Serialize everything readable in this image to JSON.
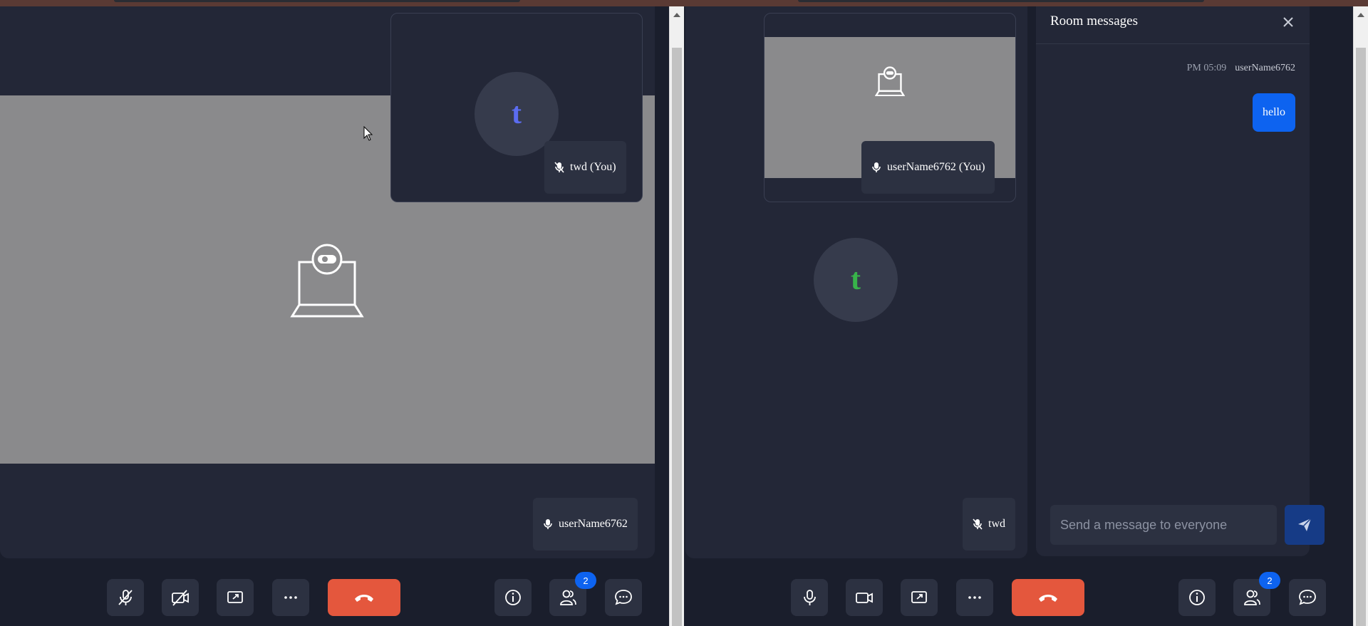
{
  "left_window": {
    "self_tile": {
      "avatar_letter": "t",
      "name": "twd (You)",
      "avatar_color": "#5b6cf0"
    },
    "main_participant": {
      "name": "userName6762"
    },
    "controls": {
      "participants_count": "2"
    }
  },
  "right_window": {
    "self_tile": {
      "name": "userName6762 (You)"
    },
    "remote_participant": {
      "avatar_letter": "t",
      "name": "twd",
      "avatar_color": "#38b34a"
    },
    "chat": {
      "title": "Room messages",
      "message": {
        "time": "PM 05:09",
        "sender": "userName6762",
        "text": "hello"
      },
      "input_placeholder": "Send a message to everyone"
    },
    "controls": {
      "participants_count": "2"
    }
  },
  "colors": {
    "background": "#1a1e2c",
    "stage": "#232737",
    "button": "#2c3141",
    "hangup": "#e4573d",
    "accent": "#0d63f0",
    "video_placeholder": "#8a8a8c"
  },
  "icons": [
    "mic-off-icon",
    "camera-off-icon",
    "share-screen-icon",
    "more-icon",
    "hangup-icon",
    "info-icon",
    "participants-icon",
    "chat-icon",
    "mic-icon",
    "camera-icon",
    "send-icon",
    "close-icon"
  ]
}
